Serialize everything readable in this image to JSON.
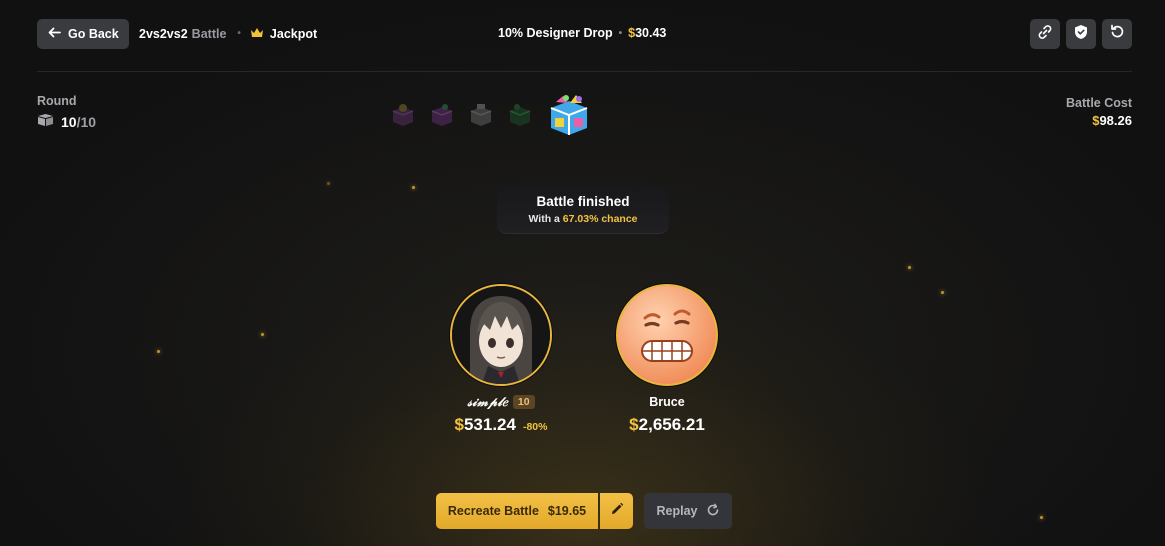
{
  "header": {
    "back_label": "Go Back",
    "mode_main": "2vs2vs2",
    "mode_suffix": "Battle",
    "jackpot_label": "Jackpot",
    "battle_name": "10% Designer Drop",
    "battle_value": "30.43",
    "currency": "$"
  },
  "round": {
    "label": "Round",
    "current": "10",
    "total": "/10"
  },
  "battle_cost": {
    "label": "Battle Cost",
    "value": "98.26"
  },
  "status": {
    "title": "Battle finished",
    "chance_prefix": "With a ",
    "chance_value": "67.03% chance"
  },
  "players": [
    {
      "name": "𝓈𝒾𝓂𝓅𝓁𝑒",
      "level": "10",
      "value": "531.24",
      "change": "-80%"
    },
    {
      "name": "Bruce",
      "value": "2,656.21"
    }
  ],
  "actions": {
    "recreate_label": "Recreate Battle",
    "recreate_price": "$19.65",
    "replay_label": "Replay"
  },
  "colors": {
    "accent": "#f3c33e",
    "button_dark": "#3a3b3f",
    "background": "#111112"
  }
}
